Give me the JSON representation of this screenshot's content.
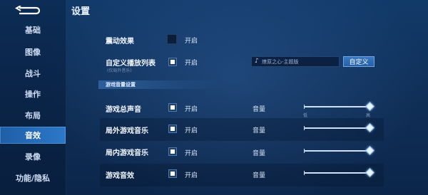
{
  "title": "设置",
  "sidebar": {
    "items": [
      {
        "label": "基础"
      },
      {
        "label": "图像"
      },
      {
        "label": "战斗"
      },
      {
        "label": "操作"
      },
      {
        "label": "布局"
      },
      {
        "label": "音效"
      },
      {
        "label": "录像"
      },
      {
        "label": "功能/隐私"
      }
    ],
    "active": "音效"
  },
  "vibration": {
    "label": "震动效果",
    "option": "开启",
    "checked": false
  },
  "playlist": {
    "label": "自定义播放列表",
    "sublabel": "(仅局外音乐)",
    "option": "开启",
    "checked": true,
    "music_value": "燎原之心-主题版",
    "button": "自定义"
  },
  "section_title": "游戏音量设置",
  "volume_rows": [
    {
      "label": "游戏总声音",
      "option": "开启",
      "checked": true,
      "volume_label": "音量",
      "low": "低",
      "high": "高",
      "level": 1.0
    },
    {
      "label": "局外游戏音乐",
      "option": "开启",
      "checked": true,
      "volume_label": "音量",
      "level": 1.0
    },
    {
      "label": "局内游戏音乐",
      "option": "开启",
      "checked": true,
      "volume_label": "音量",
      "level": 1.0
    },
    {
      "label": "游戏音效",
      "option": "开启",
      "checked": true,
      "volume_label": "音量",
      "level": 1.0
    }
  ],
  "colors": {
    "accent": "#2d78c8",
    "background": "#0f2d52"
  }
}
